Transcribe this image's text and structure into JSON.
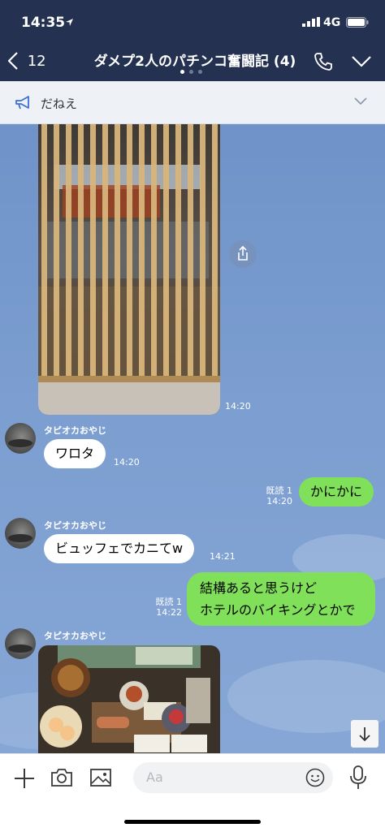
{
  "status_bar": {
    "time": "14:35",
    "network": "4G"
  },
  "header": {
    "back_count": "12",
    "title": "ダメプ2人のパチンコ奮闘記 (4)"
  },
  "announcement": {
    "text": "だねえ"
  },
  "messages": {
    "photo1_time": "14:20",
    "m1": {
      "sender": "タピオカおやじ",
      "text": "ワロタ",
      "time": "14:20"
    },
    "m2": {
      "read": "既読 1",
      "time": "14:20",
      "text": "かにかに"
    },
    "m3": {
      "sender": "タピオカおやじ",
      "text": "ビュッフェでカニてw",
      "time": "14:21"
    },
    "m4": {
      "read": "既読 1",
      "time": "14:22",
      "line1": "結構あると思うけど",
      "line2": "ホテルのバイキングとかで"
    },
    "m5": {
      "sender": "タピオカおやじ"
    }
  },
  "input": {
    "placeholder": "Aa"
  },
  "icons": {
    "status": [
      "location-arrow-icon",
      "signal-icon",
      "battery-icon"
    ],
    "header": [
      "back-chevron-icon",
      "phone-icon",
      "chevron-down-icon"
    ],
    "announcement": [
      "megaphone-icon",
      "chevron-down-icon"
    ],
    "chat": [
      "share-icon",
      "scroll-down-icon"
    ],
    "bottom_bar": [
      "plus-icon",
      "camera-icon",
      "image-icon",
      "emoji-icon",
      "microphone-icon"
    ]
  },
  "colors": {
    "header": "#243150",
    "chat_bg": "#7c9ed0",
    "outgoing_bubble": "#80e05a",
    "incoming_bubble": "#ffffff"
  }
}
